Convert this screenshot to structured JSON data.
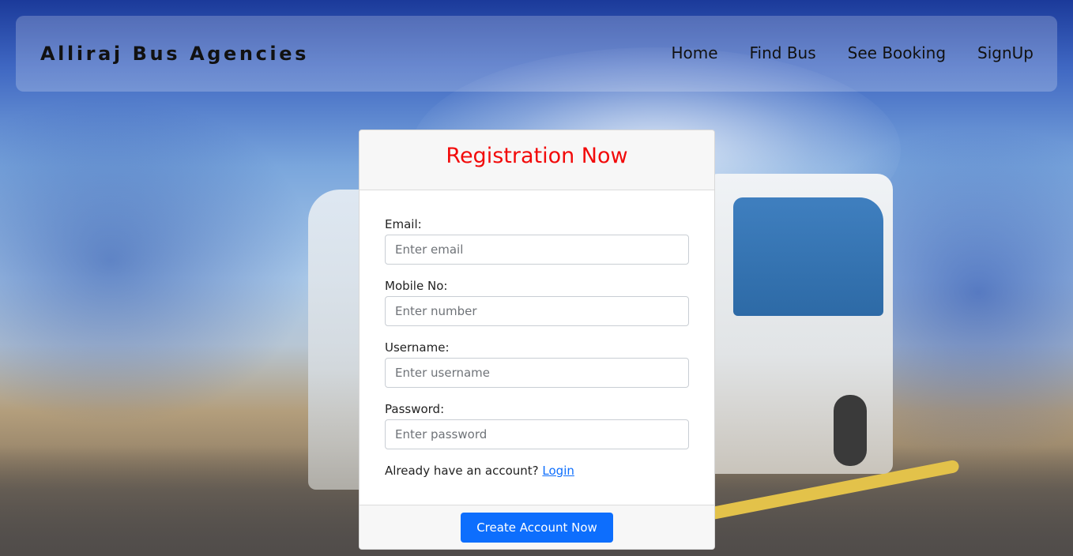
{
  "navbar": {
    "brand": "Alliraj Bus Agencies",
    "links": [
      {
        "label": "Home"
      },
      {
        "label": "Find Bus"
      },
      {
        "label": "See Booking"
      },
      {
        "label": "SignUp"
      }
    ]
  },
  "form": {
    "title": "Registration Now",
    "title_color": "#f20a0a",
    "fields": [
      {
        "label": "Email:",
        "placeholder": "Enter email",
        "value": ""
      },
      {
        "label": "Mobile No:",
        "placeholder": "Enter number",
        "value": ""
      },
      {
        "label": "Username:",
        "placeholder": "Enter username",
        "value": ""
      },
      {
        "label": "Password:",
        "placeholder": "Enter password",
        "value": ""
      }
    ],
    "login_prompt": "Already have an account?",
    "login_link": "Login",
    "submit_label": "Create Account Now",
    "accent_color": "#0d6efd"
  }
}
